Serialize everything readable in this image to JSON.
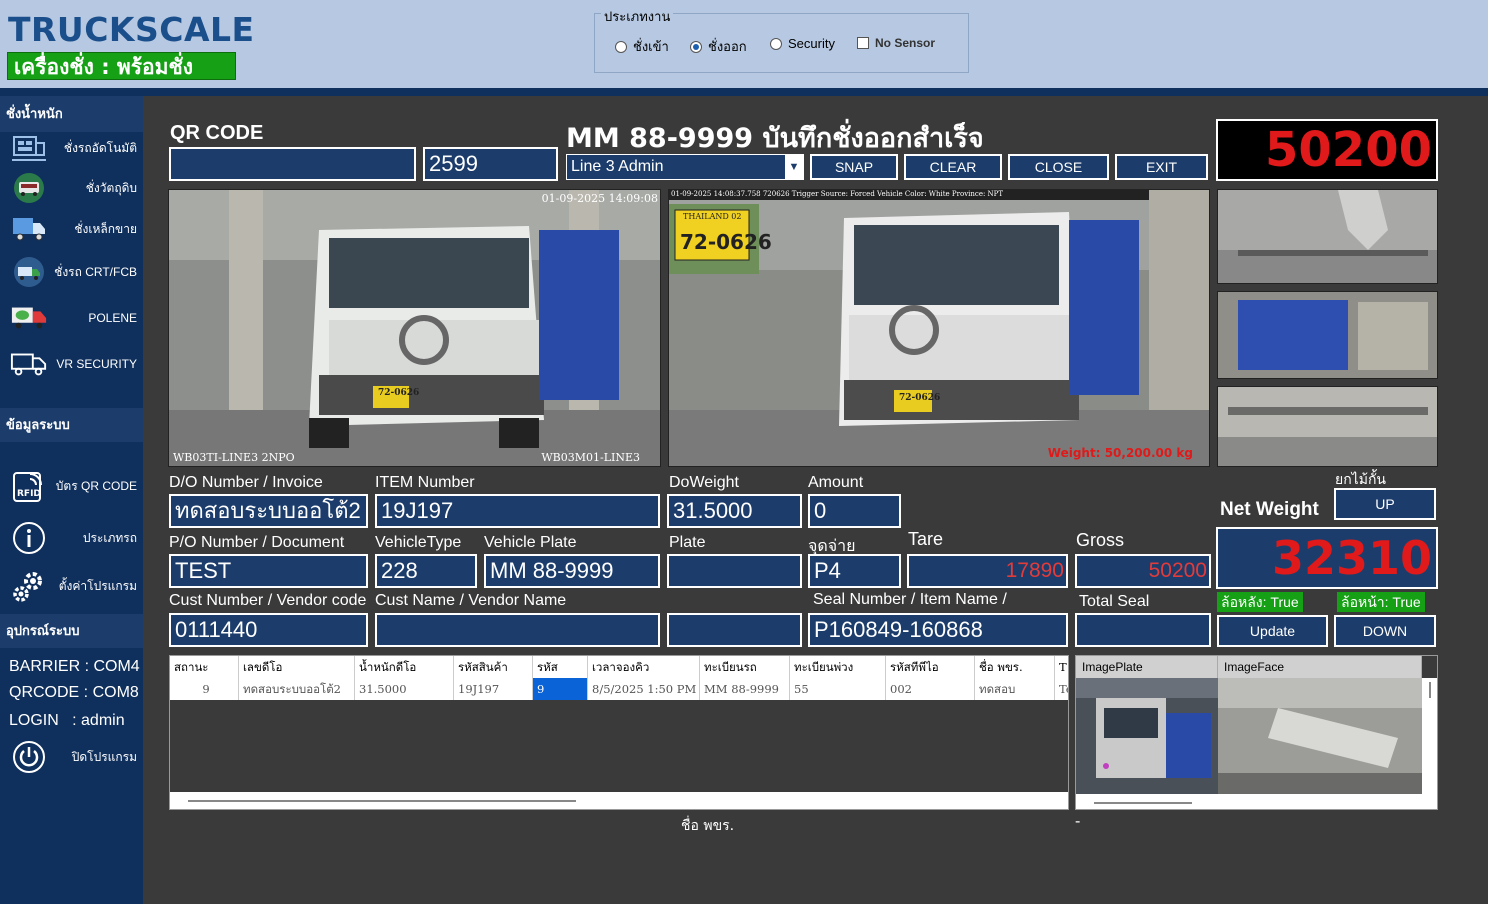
{
  "header": {
    "brand": "TRUCKSCALE",
    "status": "เครื่องชั่ง : พร้อมชั่ง",
    "jobtype_legend": "ประเภทงาน",
    "options": [
      {
        "label": "ชั่งเข้า",
        "checked": false
      },
      {
        "label": "ชั่งออก",
        "checked": true
      },
      {
        "label": "Security",
        "checked": false
      },
      {
        "label": "No Sensor",
        "checked": false
      }
    ]
  },
  "sidebar": {
    "section_weigh": "ชั่งน้ำหนัก",
    "weigh_items": [
      "ชั่งรถอัดโนมัติ",
      "ชั่งวัตถุดิบ",
      "ชั่งเหล็กขาย",
      "ชั่งรถ CRT/FCB",
      "POLENE",
      "VR SECURITY"
    ],
    "section_system": "ข้อมูลระบบ",
    "system_items": [
      "บัตร QR CODE",
      "ประเภทรถ",
      "ตั้งค่าโปรแกรม"
    ],
    "section_devices": "อุปกรณ์ระบบ",
    "barrier": "BARRIER : COM4",
    "qrcode": "QRCODE : COM8",
    "login": "LOGIN   : admin",
    "exit_label": "ปิดโปรแกรม"
  },
  "main": {
    "qr_title": "QR CODE",
    "qr_value": "",
    "qr_number": "2599",
    "title": "MM 88-9999 บันทึกชั่งออกสำเร็จ",
    "line_select": "Line 3 Admin",
    "buttons": {
      "snap": "SNAP",
      "clear": "CLEAR",
      "close": "CLOSE",
      "exit": "EXIT",
      "up": "UP",
      "update": "Update",
      "down": "DOWN"
    },
    "weight": "50200",
    "cam1": {
      "timestamp": "01-09-2025 14:09:08",
      "left_label": "WB03TI-LINE3 2NPO",
      "right_label": "WB03M01-LINE3"
    },
    "cam2": {
      "header": "01-09-2025 14:08:37.758 720626 Trigger Source: Forced Vehicle Color: White Province: NPT",
      "weight": "Weight: 50,200.00 kg",
      "plate_region": "THAILAND 02",
      "plate": "72-0626"
    },
    "truck_plate": "72-0626",
    "labels": {
      "do_number": "D/O Number / Invoice",
      "item_number": "ITEM Number",
      "do_weight": "DoWeight",
      "amount": "Amount",
      "barrier_lift": "ยกไม้กั้น",
      "net_weight": "Net Weight",
      "po_number": "P/O Number / Document",
      "vehicle_type": "VehicleType",
      "vehicle_plate": "Vehicle Plate",
      "plate": "Plate",
      "dispatch": "จุดจ่าย",
      "tare": "Tare",
      "gross": "Gross",
      "cust_number": "Cust Number / Vendor code",
      "cust_name": "Cust Name / Vendor Name",
      "seal_number": "Seal Number / Item Name /",
      "total_seal": "Total Seal"
    },
    "values": {
      "do_number": "ทดสอบระบบออโต้2",
      "item_number": "19J197",
      "do_weight": "31.5000",
      "amount": "0",
      "po_number": "TEST",
      "vehicle_type": "228",
      "vehicle_plate": "MM 88-9999",
      "plate": "",
      "dispatch": "P4",
      "tare": "17890",
      "gross": "50200",
      "cust_number": "0111440",
      "cust_name": "",
      "cust_extra": "",
      "seal_number": "P160849-160868",
      "total_seal": "",
      "net_weight": "32310",
      "rear_wheel": "ล้อหลัง: True",
      "front_wheel": "ล้อหน้า: True"
    }
  },
  "table": {
    "columns": [
      "สถานะ",
      "เลขดีโอ",
      "น้ำหนักดีโอ",
      "รหัสสินค้า",
      "รหัส",
      "เวลาจองคิว",
      "ทะเบียนรถ",
      "ทะเบียนพ่วง",
      "รหัสทีพีไอ",
      "ชื่อ พขร.",
      "T"
    ],
    "rows": [
      [
        "9",
        "ทดสอบระบบออโต้2",
        "31.5000",
        "19J197",
        "9",
        "8/5/2025 1:50 PM",
        "MM 88-9999",
        "55",
        "002",
        "ทดสอบ",
        "Te"
      ]
    ],
    "footer": "ชื่อ พขร."
  },
  "images": {
    "columns": [
      "ImagePlate",
      "ImageFace"
    ],
    "dash": "-"
  },
  "colors": {
    "accent": "#1c3d6b",
    "sidebar": "#0f2f5c",
    "ok": "#15a015",
    "weight": "#e01a1a"
  }
}
